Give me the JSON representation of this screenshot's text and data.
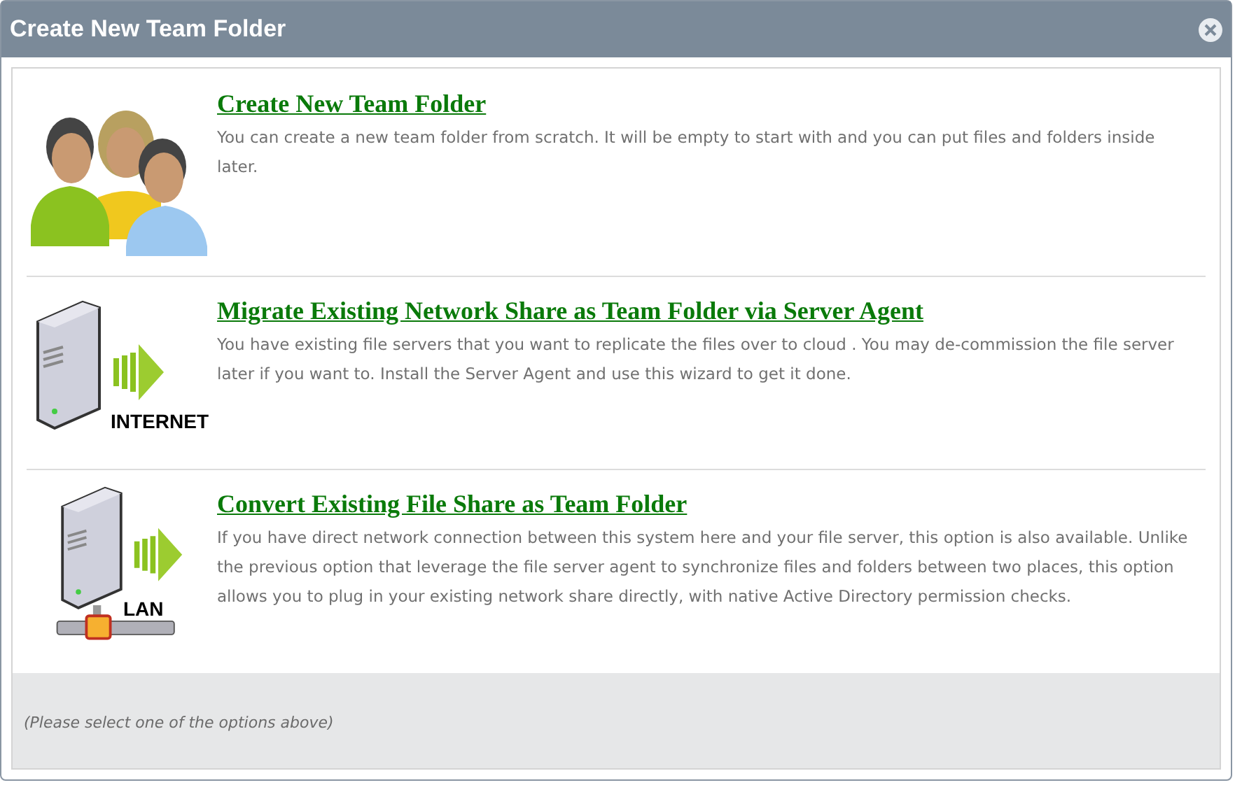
{
  "window": {
    "title": "Create New Team Folder"
  },
  "options": [
    {
      "kind": "people",
      "title": "Create New Team Folder",
      "description": "You can create a new team folder from scratch. It will be empty to start with and you can put files and folders inside later."
    },
    {
      "kind": "server-internet",
      "icon_label": "INTERNET",
      "title": "Migrate Existing Network Share as Team Folder via Server Agent",
      "description": "You have existing file servers that you want to replicate the files over to cloud . You may de-commission the file server later if you want to. Install the Server Agent and use this wizard to get it done."
    },
    {
      "kind": "server-lan",
      "icon_label": "LAN",
      "title": "Convert Existing File Share as Team Folder",
      "description": "If you have direct network connection between this system here and your file server, this option is also available. Unlike the previous option that leverage the file server agent to synchronize files and folders between two places, this option allows you to plug in your existing network share directly, with native Active Directory permission checks."
    }
  ],
  "footer": {
    "hint": "(Please select one of the options above)"
  }
}
